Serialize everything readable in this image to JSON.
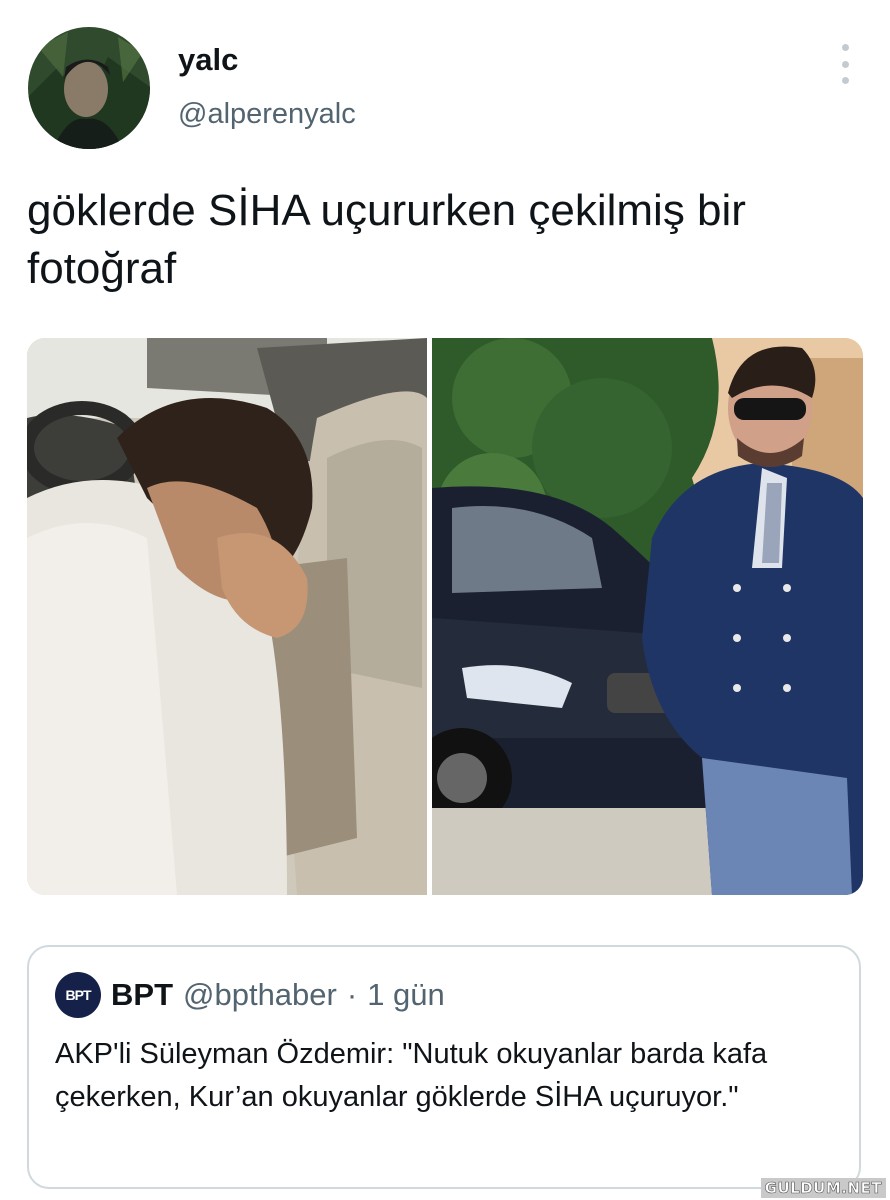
{
  "author": {
    "display_name": "yalc",
    "handle": "@alperenyalc"
  },
  "tweet": {
    "text": "göklerde SİHA uçururken çekilmiş bir fotoğraf"
  },
  "quoted_tweet": {
    "logo_text": "BPT",
    "name": "BPT",
    "handle": "@bpthaber",
    "separator": "·",
    "time": "1 gün",
    "text": "AKP'li Süleyman Özdemir: \"Nutuk okuyanlar barda kafa çekerken, Kur’an okuyanlar göklerde SİHA uçuruyor.\""
  },
  "watermark": "GULDUM.NET",
  "colors": {
    "text_primary": "#0f1419",
    "text_secondary": "#536471",
    "border": "#cfd9de",
    "quote_logo_bg": "#16214a"
  },
  "icons": {
    "more": "more-vertical-icon"
  }
}
